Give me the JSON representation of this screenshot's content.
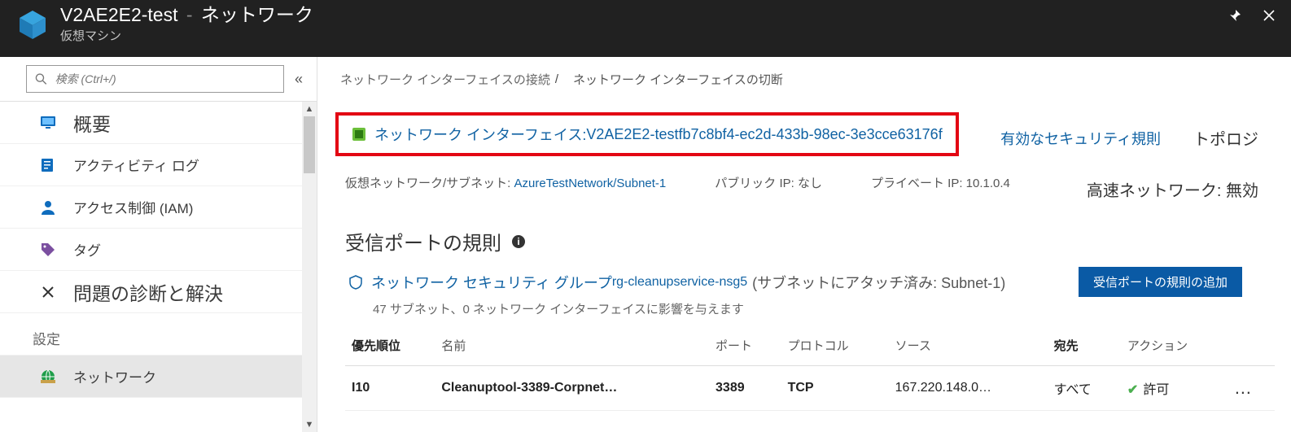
{
  "header": {
    "title_res": "V2AE2E2-test",
    "dash": " - ",
    "title_section": "ネットワーク",
    "subtitle": "仮想マシン"
  },
  "search": {
    "placeholder": "検索 (Ctrl+/)",
    "collapse_glyph": "«"
  },
  "menu": {
    "overview": "概要",
    "activity": "アクティビティ ログ",
    "iam": "アクセス制御 (IAM)",
    "tags": "タグ",
    "diagnose": "問題の診断と解決",
    "section": "設定",
    "network": "ネットワーク"
  },
  "toolbar": {
    "attach": "ネットワーク インターフェイスの接続",
    "sep": "/",
    "detach": "ネットワーク インターフェイスの切断"
  },
  "nic": {
    "label": "ネットワーク インターフェイス: ",
    "value": "V2AE2E2-testfb7c8bf4-ec2d-433b-98ec-3e3cce63176f"
  },
  "right": {
    "rules": "有効なセキュリティ規則",
    "topology": "トポロジ"
  },
  "netinfo": {
    "vn_label": "仮想ネットワーク/サブネット: ",
    "vn_value": "AzureTestNetwork/Subnet-1",
    "public_label": "パブリック IP: ",
    "public_value": "なし",
    "private_label": "プライベート IP: ",
    "private_value": "10.1.0.4",
    "accel_label": "高速ネットワーク: ",
    "accel_value": "無効"
  },
  "rules": {
    "title": "受信ポートの規則",
    "nsg_prefix": "ネットワーク セキュリティ グループ ",
    "nsg_name": "rg-cleanupservice-nsg5",
    "nsg_attach": " (サブネットにアタッチ済み: Subnet-1)",
    "sub": "47 サブネット、0 ネットワーク インターフェイスに影響を与えます",
    "add_btn": "受信ポートの規則の追加",
    "cols": {
      "pri": "優先順位",
      "name": "名前",
      "port": "ポート",
      "proto": "プロトコル",
      "src": "ソース",
      "dst": "宛先",
      "action": "アクション"
    },
    "row1": {
      "pri": "I10",
      "name": "Cleanuptool-3389-Corpnet…",
      "port": "3389",
      "proto": "TCP",
      "src": "167.220.148.0…",
      "dst": "すべて",
      "action": "許可",
      "more": "…"
    }
  }
}
